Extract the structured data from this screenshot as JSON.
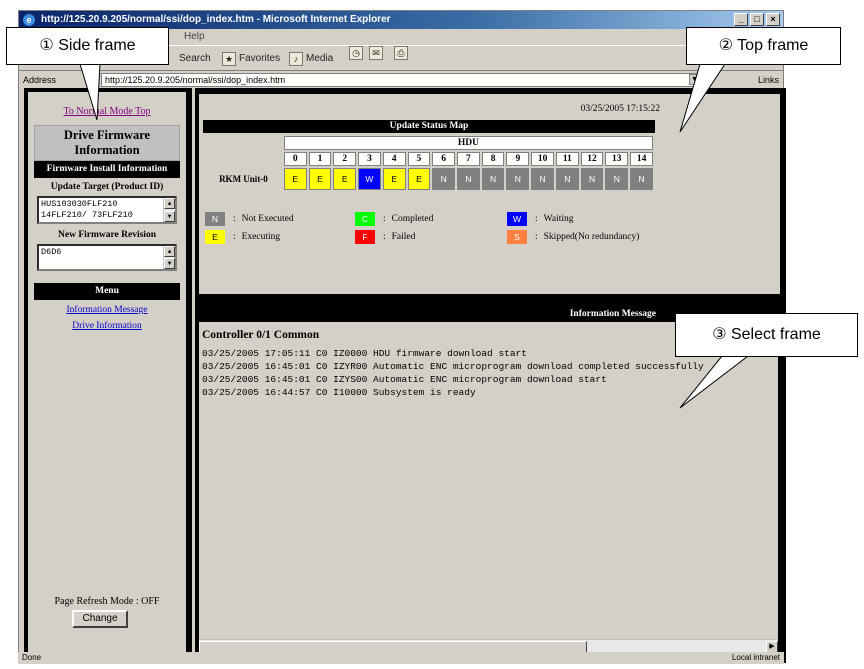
{
  "browser": {
    "title": "http://125.20.9.205/normal/ssi/dop_index.htm - Microsoft Internet Explorer",
    "menu_visible": "Help",
    "toolbar": {
      "search": "Search",
      "favorites": "Favorites",
      "media": "Media"
    },
    "address_label": "Address",
    "address_url": "http://125.20.9.205/normal/ssi/dop_index.htm",
    "links_label": "Links",
    "status_left": "Done",
    "status_zone": "Local intranet"
  },
  "callouts": {
    "side": "① Side frame",
    "top": "② Top frame",
    "select": "③ Select frame"
  },
  "side_frame": {
    "top_link": "To Normal Mode Top",
    "section_title": "Drive Firmware Information",
    "install_header": "Firmware Install Information",
    "update_target_label": "Update Target (Product ID)",
    "product_ids": [
      "HUS103030FLF210",
      "14FLF210/ 73FLF210"
    ],
    "new_revision_label": "New Firmware Revision",
    "new_revision_value": "D6D6",
    "menu_header": "Menu",
    "menu_links": [
      "Information Message",
      "Drive Information"
    ],
    "refresh_mode": "Page Refresh Mode : OFF",
    "change_button": "Change"
  },
  "top_frame": {
    "timestamp": "03/25/2005 17:15:22",
    "map_title": "Update Status Map",
    "hdu_header": "HDU",
    "hdu_numbers": [
      "0",
      "1",
      "2",
      "3",
      "4",
      "5",
      "6",
      "7",
      "8",
      "9",
      "10",
      "11",
      "12",
      "13",
      "14"
    ],
    "unit_label": "RKM Unit-0",
    "statuses": [
      "E",
      "E",
      "E",
      "W",
      "E",
      "E",
      "N",
      "N",
      "N",
      "N",
      "N",
      "N",
      "N",
      "N",
      "N"
    ],
    "status_colors": {
      "N": "#808080",
      "E": "#ffff00",
      "W": "#0000ff",
      "C": "#00ff00",
      "F": "#ff0000",
      "S": "#ff8040"
    },
    "legend": [
      {
        "code": "N",
        "sep": ":",
        "label": "Not Executed"
      },
      {
        "code": "C",
        "sep": ":",
        "label": "Completed"
      },
      {
        "code": "W",
        "sep": ":",
        "label": "Waiting"
      },
      {
        "code": "E",
        "sep": ":",
        "label": "Executing"
      },
      {
        "code": "F",
        "sep": ":",
        "label": "Failed"
      },
      {
        "code": "S",
        "sep": ":",
        "label": "Skipped(No redundancy)"
      }
    ]
  },
  "select_frame": {
    "title": "Information Message",
    "section": "Controller 0/1 Common",
    "log": [
      "03/25/2005 17:05:11 C0 IZ0000 HDU firmware download start",
      "03/25/2005 16:45:01 C0 IZYR00 Automatic ENC microprogram download completed successfully",
      "03/25/2005 16:45:01 C0 IZYS00 Automatic ENC microprogram download start",
      "03/25/2005 16:44:57 C0 I10000 Subsystem is ready"
    ]
  }
}
